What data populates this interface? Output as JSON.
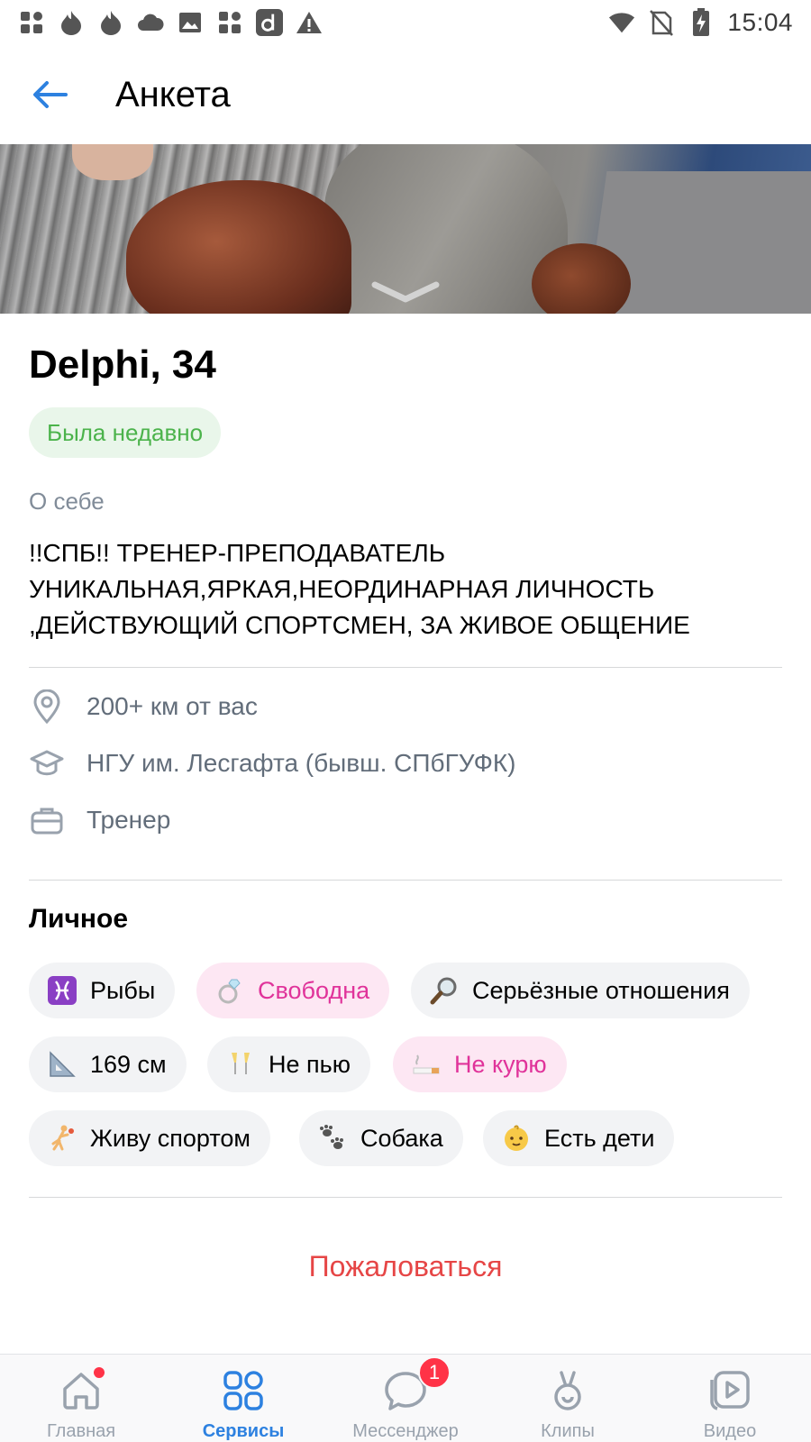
{
  "status_bar": {
    "time": "15:04",
    "left_icons": [
      "apps-icon",
      "flame-icon",
      "flame-icon",
      "cloud-icon",
      "image-icon",
      "apps-icon",
      "d-app-icon",
      "warning-icon"
    ],
    "right_icons": [
      "wifi-icon",
      "no-sim-icon",
      "battery-charging-icon"
    ]
  },
  "header": {
    "title": "Анкета",
    "back_icon": "arrow-left-icon"
  },
  "profile": {
    "name_age": "Delphi, 34",
    "online_status": "Была недавно",
    "about_label": "О себе",
    "about_lines": [
      "!!СПБ!! ТРЕНЕР-ПРЕПОДАВАТЕЛЬ",
      "УНИКАЛЬНАЯ,ЯРКАЯ,НЕОРДИНАРНАЯ ЛИЧНОСТЬ",
      ",ДЕЙСТВУЮЩИЙ СПОРТСМЕН, ЗА ЖИВОЕ ОБЩЕНИЕ"
    ]
  },
  "info": {
    "distance": "200+ км от вас",
    "education": "НГУ им. Лесгафта (бывш. СПбГУФК)",
    "job": "Тренер"
  },
  "personal": {
    "title": "Личное",
    "chips": [
      {
        "label": "Рыбы",
        "emoji": "♓",
        "highlight": false
      },
      {
        "label": "Свободна",
        "emoji": "💍",
        "highlight": true
      },
      {
        "label": "Серьёзные отношения",
        "emoji": "🔎",
        "highlight": false
      },
      {
        "label": "169 см",
        "emoji": "📐",
        "highlight": false
      },
      {
        "label": "Не пью",
        "emoji": "🥂",
        "highlight": false
      },
      {
        "label": "Не курю",
        "emoji": "🚬",
        "highlight": true
      },
      {
        "label": "Живу спортом",
        "emoji": "🤾",
        "highlight": false
      },
      {
        "label": "Собака",
        "emoji": "🐾",
        "highlight": false
      },
      {
        "label": "Есть дети",
        "emoji": "👶",
        "highlight": false
      }
    ]
  },
  "report_label": "Пожаловаться",
  "bottom_nav": {
    "items": [
      {
        "label": "Главная",
        "icon": "home-icon"
      },
      {
        "label": "Сервисы",
        "icon": "services-icon"
      },
      {
        "label": "Мессенджер",
        "icon": "chat-icon",
        "badge": "1"
      },
      {
        "label": "Клипы",
        "icon": "clips-icon"
      },
      {
        "label": "Видео",
        "icon": "video-icon"
      }
    ]
  },
  "colors": {
    "accent": "#2d81e0",
    "online_green": "#4bb34b",
    "pink": "#e0339a",
    "report_red": "#e64646"
  }
}
